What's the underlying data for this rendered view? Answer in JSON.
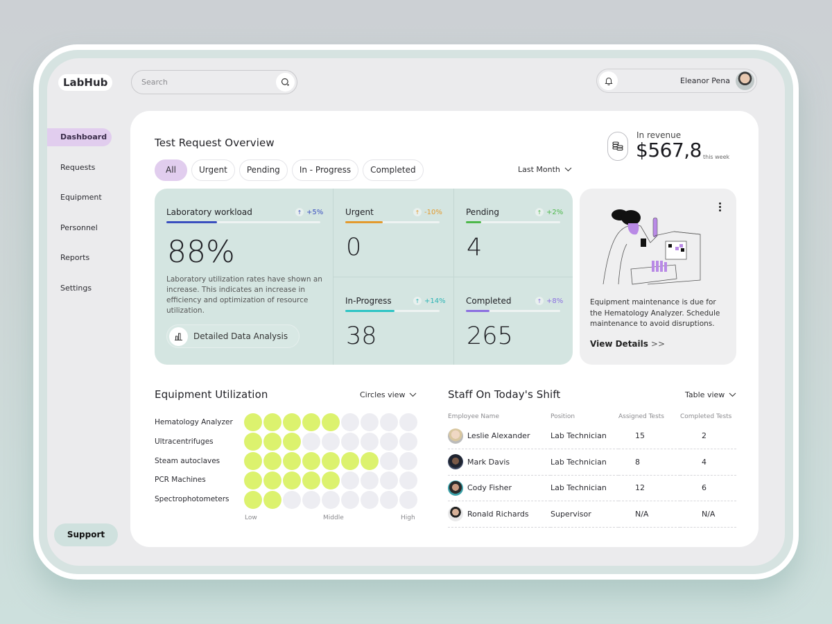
{
  "app": {
    "name": "LabHub"
  },
  "search": {
    "placeholder": "Search"
  },
  "user": {
    "name": "Eleanor Pena"
  },
  "sidebar": {
    "items": [
      {
        "label": "Dashboard",
        "active": true
      },
      {
        "label": "Requests"
      },
      {
        "label": "Equipment"
      },
      {
        "label": "Personnel"
      },
      {
        "label": "Reports"
      },
      {
        "label": "Settings"
      }
    ],
    "support_label": "Support"
  },
  "overview": {
    "title": "Test Request Overview",
    "filters": [
      "All",
      "Urgent",
      "Pending",
      "In - Progress",
      "Completed"
    ],
    "active_filter": "All",
    "period": "Last Month",
    "revenue": {
      "label": "In revenue",
      "value": "$567,8",
      "suffix": "this week"
    }
  },
  "stats": {
    "workload": {
      "title": "Laboratory workload",
      "change": "+5%",
      "value": "88%",
      "progress": 0.33,
      "color": "#3a4fbf",
      "description": "Laboratory utilization rates have shown an increase. This indicates an increase in efficiency and optimization of resource utilization.",
      "button_label": "Detailed Data Analysis"
    },
    "cards": [
      {
        "title": "Urgent",
        "change": "-10%",
        "value": "0",
        "progress": 0.4,
        "color": "#e39a2d"
      },
      {
        "title": "Pending",
        "change": "+2%",
        "value": "4",
        "progress": 0.16,
        "color": "#4db84a"
      },
      {
        "title": "In-Progress",
        "change": "+14%",
        "value": "38",
        "progress": 0.52,
        "color": "#2cc4c4"
      },
      {
        "title": "Completed",
        "change": "+8%",
        "value": "265",
        "progress": 0.25,
        "color": "#8a6ee0"
      }
    ]
  },
  "maintenance": {
    "text": "Equipment maintenance is due for the Hematology Analyzer. Schedule maintenance to avoid disruptions.",
    "link_label": "View Details",
    "link_icon": ">>"
  },
  "equipment": {
    "title": "Equipment Utilization",
    "view": "Circles view",
    "max_level": 9,
    "items": [
      {
        "name": "Hematology Analyzer",
        "level": 5
      },
      {
        "name": "Ultracentrifuges",
        "level": 3
      },
      {
        "name": "Steam autoclaves",
        "level": 7
      },
      {
        "name": "PCR Machines",
        "level": 5
      },
      {
        "name": "Spectrophotometers",
        "level": 2
      }
    ],
    "scale": {
      "low": "Low",
      "middle": "Middle",
      "high": "High"
    },
    "on_color": "#dcf26e",
    "off_color": "#ededf2"
  },
  "staff": {
    "title": "Staff On Today's Shift",
    "view": "Table view",
    "columns": [
      "Employee Name",
      "Position",
      "Assigned Tests",
      "Completed Tests"
    ],
    "rows": [
      {
        "name": "Leslie Alexander",
        "position": "Lab Technician",
        "assigned": "15",
        "completed": "2"
      },
      {
        "name": "Mark Davis",
        "position": "Lab Technician",
        "assigned": "8",
        "completed": "4"
      },
      {
        "name": "Cody Fisher",
        "position": "Lab Technician",
        "assigned": "12",
        "completed": "6"
      },
      {
        "name": "Ronald Richards",
        "position": "Supervisor",
        "assigned": "N/A",
        "completed": "N/A"
      }
    ]
  }
}
